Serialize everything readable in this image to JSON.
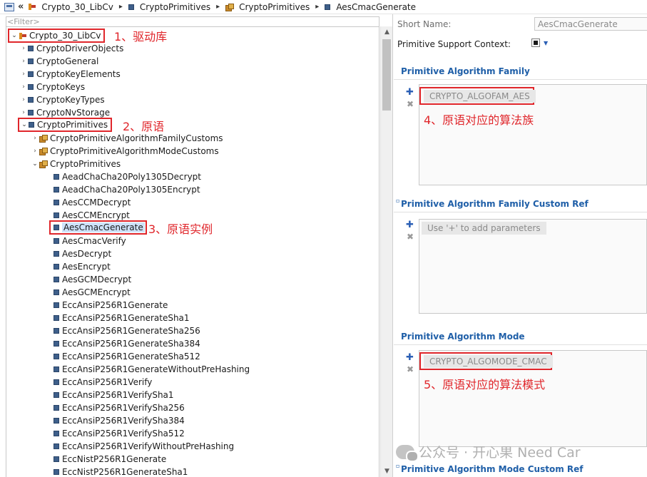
{
  "breadcrumb": {
    "items": [
      "Crypto_30_LibCv",
      "CryptoPrimitives",
      "CryptoPrimitives",
      "AesCmacGenerate"
    ],
    "separator": "▸"
  },
  "filter": {
    "placeholder": "<Filter>"
  },
  "tree": {
    "root": "Crypto_30_LibCv",
    "top_items": [
      "CryptoDriverObjects",
      "CryptoGeneral",
      "CryptoKeyElements",
      "CryptoKeys",
      "CryptoKeyTypes",
      "CryptoNvStorage"
    ],
    "primitives_node": "CryptoPrimitives",
    "primitives_children": [
      "CryptoPrimitiveAlgorithmFamilyCustoms",
      "CryptoPrimitiveAlgorithmModeCustoms",
      "CryptoPrimitives"
    ],
    "leaf_items": [
      "AeadChaCha20Poly1305Decrypt",
      "AeadChaCha20Poly1305Encrypt",
      "AesCCMDecrypt",
      "AesCCMEncrypt",
      "AesCmacGenerate",
      "AesCmacVerify",
      "AesDecrypt",
      "AesEncrypt",
      "AesGCMDecrypt",
      "AesGCMEncrypt",
      "EccAnsiP256R1Generate",
      "EccAnsiP256R1GenerateSha1",
      "EccAnsiP256R1GenerateSha256",
      "EccAnsiP256R1GenerateSha384",
      "EccAnsiP256R1GenerateSha512",
      "EccAnsiP256R1GenerateWithoutPreHashing",
      "EccAnsiP256R1Verify",
      "EccAnsiP256R1VerifySha1",
      "EccAnsiP256R1VerifySha256",
      "EccAnsiP256R1VerifySha384",
      "EccAnsiP256R1VerifySha512",
      "EccAnsiP256R1VerifyWithoutPreHashing",
      "EccNistP256R1Generate",
      "EccNistP256R1GenerateSha1"
    ],
    "selected": "AesCmacGenerate"
  },
  "annotations": [
    "1、驱动库",
    "2、原语",
    "3、原语实例",
    "4、原语对应的算法族",
    "5、原语对应的算法模式"
  ],
  "props": {
    "short_name_label": "Short Name:",
    "short_name_value": "AesCmacGenerate",
    "context_label": "Primitive Support Context:",
    "family_title": "Primitive Algorithm Family",
    "family_value": "CRYPTO_ALGOFAM_AES",
    "family_custom_title": "Primitive Algorithm Family Custom Ref",
    "family_custom_placeholder": "Use '+' to add parameters",
    "mode_title": "Primitive Algorithm Mode",
    "mode_value": "CRYPTO_ALGOMODE_CMAC",
    "mode_custom_title": "Primitive Algorithm Mode Custom Ref"
  },
  "watermark": "公众号 · 开心果 Need Car",
  "colors": {
    "annotation_red": "#e0262b",
    "header_blue": "#1f5fa8",
    "selection": "#cfe3fa"
  }
}
